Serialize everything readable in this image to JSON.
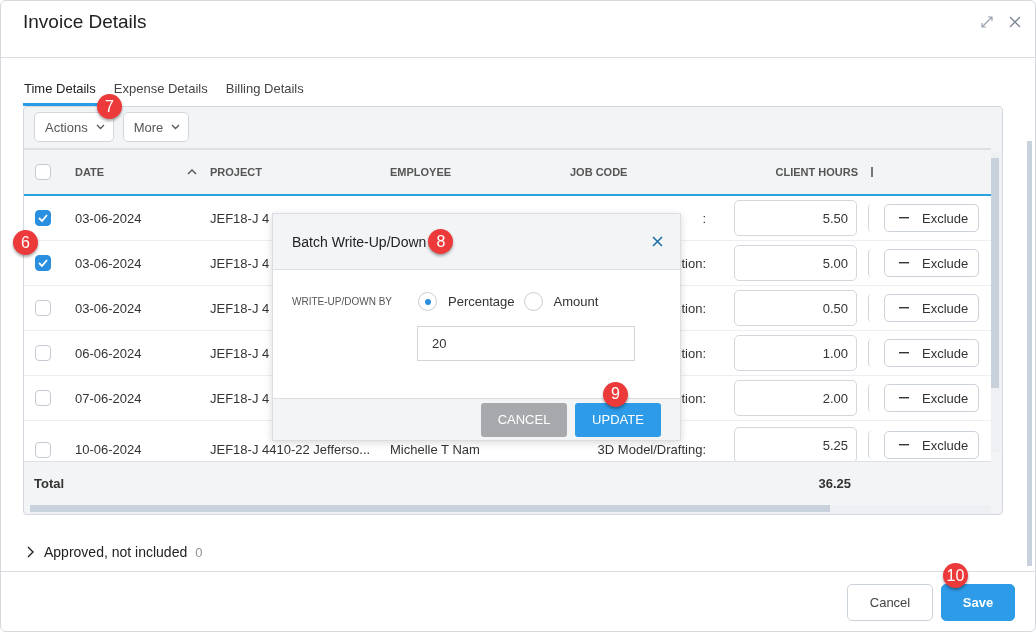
{
  "window": {
    "title": "Invoice Details"
  },
  "tabs": [
    {
      "label": "Time Details",
      "selected": true
    },
    {
      "label": "Expense Details",
      "selected": false
    },
    {
      "label": "Billing Details",
      "selected": false
    }
  ],
  "toolbar": [
    {
      "label": "Actions",
      "callout": "7"
    },
    {
      "label": "More"
    }
  ],
  "table": {
    "header_checkbox": {
      "checked": false
    },
    "columns": [
      {
        "label": "DATE",
        "sorted": true
      },
      {
        "label": "PROJECT"
      },
      {
        "label": "EMPLOYEE"
      },
      {
        "label": "JOB CODE"
      },
      {
        "label": "CLIENT HOURS"
      }
    ],
    "rows": [
      {
        "checked": true,
        "date": "03-06-2024",
        "project": "JEF18-J 4",
        "job_code": ":",
        "client_hours": "5.50",
        "action": "Exclude"
      },
      {
        "checked": true,
        "date": "03-06-2024",
        "project": "JEF18-J 4",
        "job_code": "tion:",
        "client_hours": "5.00",
        "action": "Exclude",
        "callout": "6"
      },
      {
        "checked": false,
        "date": "03-06-2024",
        "project": "JEF18-J 4",
        "job_code": "tion:",
        "client_hours": "0.50",
        "action": "Exclude"
      },
      {
        "checked": false,
        "date": "06-06-2024",
        "project": "JEF18-J 4",
        "job_code": "tion:",
        "client_hours": "1.00",
        "action": "Exclude"
      },
      {
        "checked": false,
        "date": "07-06-2024",
        "project": "JEF18-J 4",
        "job_code": "tion:",
        "client_hours": "2.00",
        "action": "Exclude"
      },
      {
        "checked": false,
        "date": "10-06-2024",
        "project": "JEF18-J 4410-22 Jefferso...",
        "employee": "Michelle T Nam",
        "job_code": "3D Model/Drafting:",
        "client_hours": "5.25",
        "action": "Exclude"
      }
    ],
    "total": {
      "label": "Total",
      "client_hours": "36.25"
    }
  },
  "dialog": {
    "title": "Batch Write-Up/Down",
    "callout": "8",
    "field_label": "WRITE-UP/DOWN BY",
    "options": [
      {
        "label": "Percentage",
        "selected": true
      },
      {
        "label": "Amount",
        "selected": false
      }
    ],
    "value": "20",
    "buttons": [
      {
        "label": "CANCEL",
        "kind": "secondary"
      },
      {
        "label": "UPDATE",
        "kind": "primary",
        "callout": "9"
      }
    ]
  },
  "section": {
    "label": "Approved, not included",
    "count": "0",
    "expanded": false
  },
  "footer": {
    "buttons": [
      {
        "label": "Cancel",
        "kind": "secondary"
      },
      {
        "label": "Save",
        "kind": "primary",
        "callout": "10"
      }
    ]
  }
}
